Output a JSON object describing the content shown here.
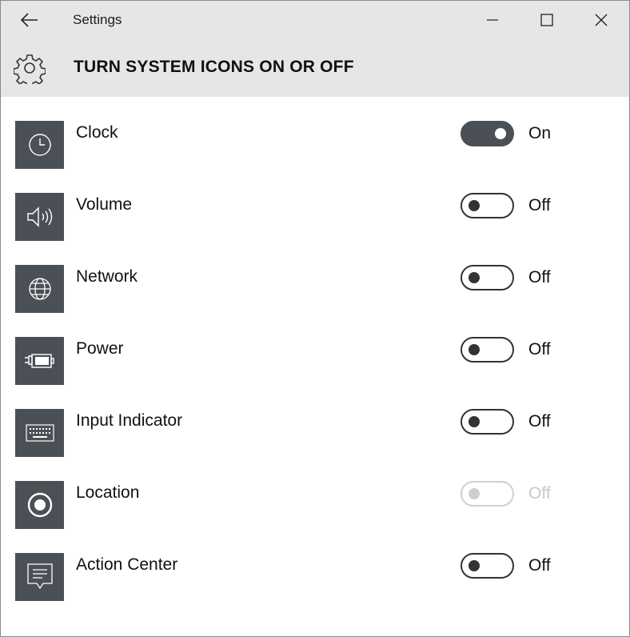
{
  "window": {
    "title": "Settings",
    "back_icon": "back-arrow-icon",
    "minimize_icon": "minimize-icon",
    "maximize_icon": "maximize-icon",
    "close_icon": "close-icon"
  },
  "header": {
    "icon": "gear-icon",
    "title": "TURN SYSTEM ICONS ON OR OFF"
  },
  "colors": {
    "tile_background": "#4a5056",
    "header_background": "#e6e6e6",
    "toggle_on": "#4a5056",
    "disabled": "#c8c8c8"
  },
  "items": [
    {
      "label": "Clock",
      "icon": "clock-icon",
      "state": "On",
      "on": true,
      "enabled": true
    },
    {
      "label": "Volume",
      "icon": "volume-icon",
      "state": "Off",
      "on": false,
      "enabled": true
    },
    {
      "label": "Network",
      "icon": "network-globe-icon",
      "state": "Off",
      "on": false,
      "enabled": true
    },
    {
      "label": "Power",
      "icon": "power-battery-icon",
      "state": "Off",
      "on": false,
      "enabled": true
    },
    {
      "label": "Input Indicator",
      "icon": "keyboard-icon",
      "state": "Off",
      "on": false,
      "enabled": true
    },
    {
      "label": "Location",
      "icon": "location-icon",
      "state": "Off",
      "on": false,
      "enabled": false
    },
    {
      "label": "Action Center",
      "icon": "action-center-icon",
      "state": "Off",
      "on": false,
      "enabled": true
    }
  ]
}
